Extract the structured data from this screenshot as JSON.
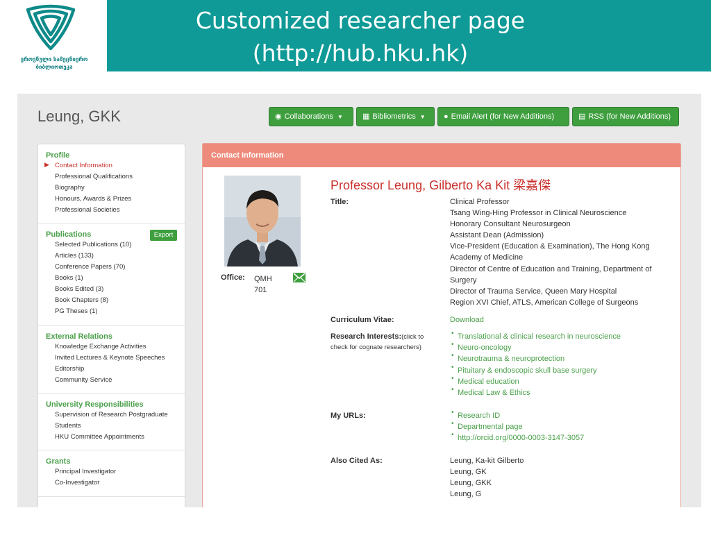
{
  "slide": {
    "logo_caption_1": "ეროვნული სამეცნიერო",
    "logo_caption_2": "ბიბლიოთეკა",
    "title_line1": "Customized researcher page",
    "title_line2": "(http://hub.hku.hk)"
  },
  "colors": {
    "teal": "#0f9a97",
    "green_button": "#3f9f3f",
    "panel_header": "#ee8a7b",
    "accent_red": "#c9302c"
  },
  "page": {
    "researcher_name": "Leung, GKK",
    "toolbar": {
      "collaborations": "Collaborations",
      "bibliometrics": "Bibliometrics",
      "email_alert": "Email Alert (for New Additions)",
      "rss": "RSS (for New Additions)"
    }
  },
  "sidebar": {
    "profile": {
      "heading": "Profile",
      "items": [
        "Contact Information",
        "Professional Qualifications",
        "Biography",
        "Honours, Awards & Prizes",
        "Professional Societies"
      ]
    },
    "publications": {
      "heading": "Publications",
      "export_label": "Export",
      "items": [
        "Selected Publications (10)",
        "Articles (133)",
        "Conference Papers (70)",
        "Books (1)",
        "Books Edited (3)",
        "Book Chapters (8)",
        "PG Theses (1)"
      ]
    },
    "external": {
      "heading": "External Relations",
      "items": [
        "Knowledge Exchange Activities",
        "Invited Lectures & Keynote Speeches",
        "Editorship",
        "Community Service"
      ]
    },
    "university": {
      "heading": "University Responsibilities",
      "items": [
        "Supervision of Research Postgraduate",
        "Students",
        "HKU Committee Appointments"
      ]
    },
    "grants": {
      "heading": "Grants",
      "items": [
        "Principal Investigator",
        "Co-Investigator"
      ]
    }
  },
  "contact": {
    "panel_title": "Contact Information",
    "name": "Professor Leung, Gilberto Ka Kit",
    "name_chinese": "梁嘉傑",
    "office_label": "Office:",
    "office_value_1": "QMH",
    "office_value_2": "701",
    "title_label": "Title:",
    "titles": [
      "Clinical Professor",
      "Tsang Wing-Hing Professor in Clinical Neuroscience",
      "Honorary Consultant Neurosurgeon",
      "Assistant Dean (Admission)",
      "Vice-President (Education & Examination), The Hong Kong",
      "Academy of Medicine",
      "Director of Centre of Education and Training, Department of",
      "Surgery",
      "Director of Trauma Service, Queen Mary Hospital",
      "Region XVI Chief, ATLS, American College of Surgeons"
    ],
    "cv_label": "Curriculum Vitae:",
    "cv_link": "Download",
    "ri_label": "Research Interests:",
    "ri_hint_1": "(click to",
    "ri_hint_2": "check for cognate researchers)",
    "research_interests": [
      "Translational & clinical research in neuroscience",
      "Neuro-oncology",
      "Neurotrauma & neuroprotection",
      "Pituitary & endoscopic skull base surgery",
      "Medical education",
      "Medical Law & Ethics"
    ],
    "urls_label": "My URLs:",
    "urls": [
      "Research ID",
      "Departmental page",
      "http://orcid.org/0000-0003-3147-3057"
    ],
    "cited_label": "Also Cited As:",
    "cited_as": [
      "Leung, Ka-kit Gilberto",
      "Leung, GK",
      "Leung, GKK",
      "Leung, G"
    ]
  }
}
